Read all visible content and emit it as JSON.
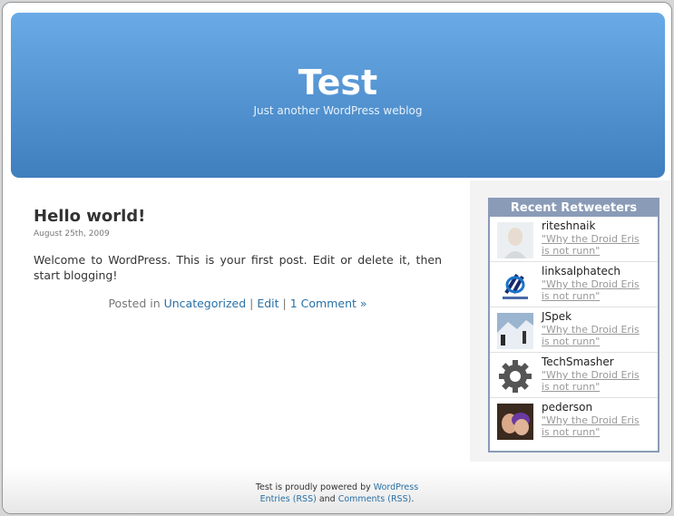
{
  "header": {
    "blog_title": "Test",
    "blog_description": "Just another WordPress weblog"
  },
  "post": {
    "title": "Hello world!",
    "date": "August 25th, 2009",
    "body": "Welcome to WordPress. This is your first post. Edit or delete it, then start blogging!",
    "meta_prefix": "Posted in ",
    "category": "Uncategorized",
    "sep1": " | ",
    "edit": "Edit",
    "sep2": " | ",
    "comments": "1 Comment »"
  },
  "widget": {
    "title": "Recent Retweeters",
    "items": [
      {
        "name": "riteshnaik",
        "tweet": "\"Why the Droid Eris is not runn\"",
        "avatar": "person-avatar"
      },
      {
        "name": "linksalphatech",
        "tweet": "\"Why the Droid Eris is not runn\"",
        "avatar": "links-logo-avatar"
      },
      {
        "name": "JSpek",
        "tweet": "\"Why the Droid Eris is not runn\"",
        "avatar": "snow-scene-avatar"
      },
      {
        "name": "TechSmasher",
        "tweet": "\"Why the Droid Eris is not runn\"",
        "avatar": "gear-avatar"
      },
      {
        "name": "pederson",
        "tweet": "\"Why the Droid Eris is not runn\"",
        "avatar": "couple-photo-avatar"
      }
    ]
  },
  "footer": {
    "text1": "Test is proudly powered by ",
    "wordpress": "WordPress",
    "entries": "Entries (RSS)",
    "and": " and ",
    "comments": "Comments (RSS)",
    "end": "."
  },
  "colors": {
    "header_top": "#6aaae6",
    "header_bottom": "#3f7fbe",
    "link": "#2970a6",
    "widget_border": "#8a9bb8"
  }
}
